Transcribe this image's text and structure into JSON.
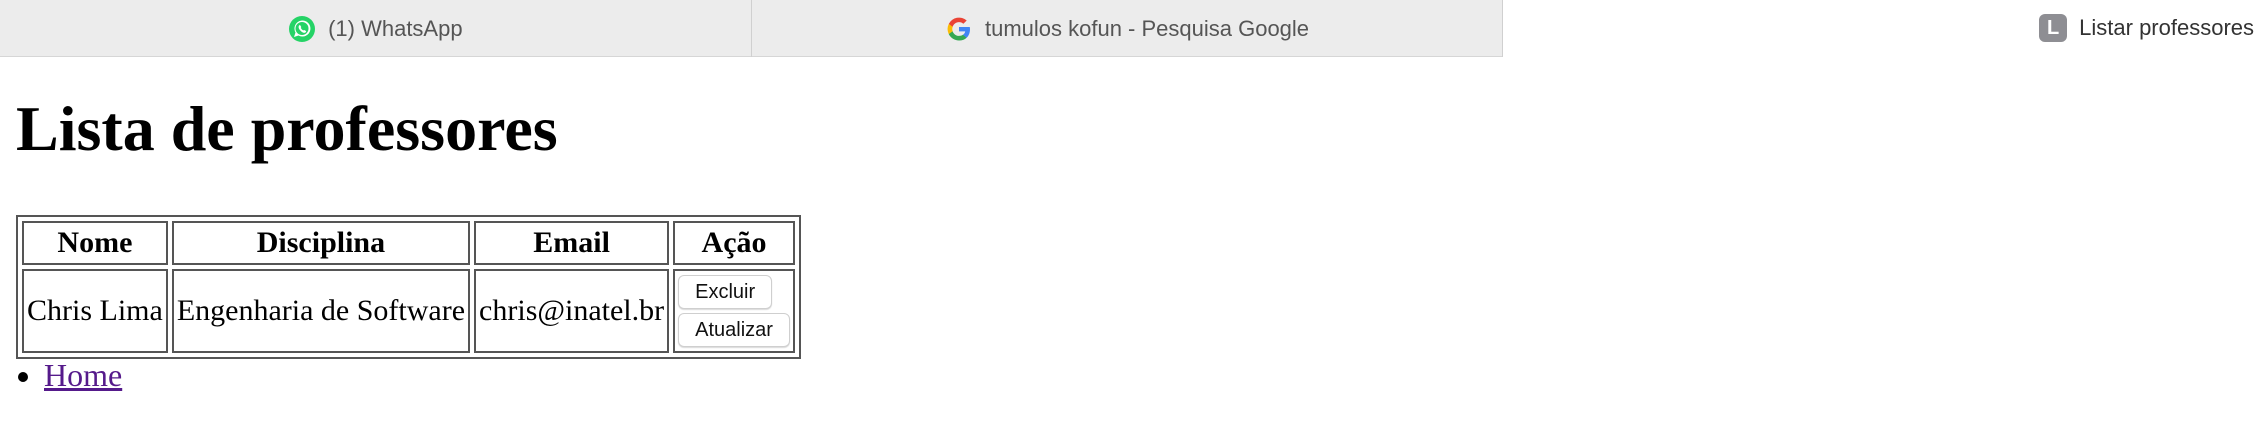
{
  "tabs": [
    {
      "title": "(1) WhatsApp",
      "icon": "whatsapp-icon",
      "active": false
    },
    {
      "title": "tumulos kofun - Pesquisa Google",
      "icon": "google-icon",
      "active": false
    },
    {
      "title": "Listar professores",
      "icon": "letter-l-icon",
      "icon_letter": "L",
      "active": true
    }
  ],
  "page": {
    "heading": "Lista de professores",
    "table": {
      "headers": [
        "Nome",
        "Disciplina",
        "Email",
        "Ação"
      ],
      "rows": [
        {
          "nome": "Chris Lima",
          "disciplina": "Engenharia de Software",
          "email": "chris@inatel.br",
          "actions": {
            "delete_label": "Excluir",
            "update_label": "Atualizar"
          }
        }
      ]
    },
    "links": [
      {
        "label": "Home"
      }
    ]
  },
  "colors": {
    "whatsapp_green": "#25D366",
    "link_visited": "#551a8b",
    "tab_bar_bg": "#ececec",
    "active_tab_bg": "#ffffff"
  }
}
